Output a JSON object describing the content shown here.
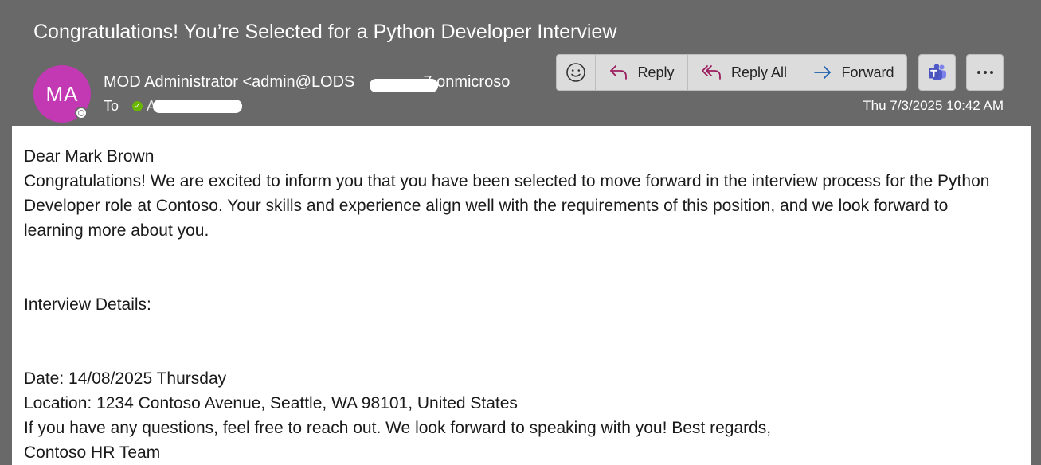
{
  "message": {
    "subject": "Congratulations! You’re Selected for a Python Developer Interview",
    "avatar_initials": "MA",
    "sender_name_part1": "MOD Administrator <admin@LODS",
    "sender_name_part2": "7.onmicroso",
    "to_label": "To",
    "to_name_visible": "An",
    "timestamp": "Thu 7/3/2025 10:42 AM"
  },
  "toolbar": {
    "emoji_icon": "emoji-smile-icon",
    "reply_label": "Reply",
    "reply_all_label": "Reply All",
    "forward_label": "Forward",
    "teams_icon": "teams-icon",
    "more_icon": "more-actions-icon"
  },
  "body": {
    "greeting": "Dear Mark Brown",
    "paragraph1": "Congratulations! We are excited to inform you that you have been selected to move forward in the interview process for the Python Developer role at Contoso. Your skills and experience align well with the requirements of this position, and we look forward to learning more about you.",
    "details_heading": "Interview Details:",
    "date_line": "Date: 14/08/2025 Thursday",
    "location_line": "Location: 1234 Contoso Avenue, Seattle, WA 98101, United States",
    "closing_line": "If you have any questions, feel free to reach out. We look forward to speaking with you! Best regards,",
    "signature": "Contoso HR Team"
  },
  "colors": {
    "header_bg": "#696969",
    "avatar_bg": "#c239b3",
    "reply_icon": "#9b1c5e",
    "forward_icon": "#1f62b0",
    "teams_tile": "#4b53bc",
    "presence_available": "#6bb700"
  }
}
